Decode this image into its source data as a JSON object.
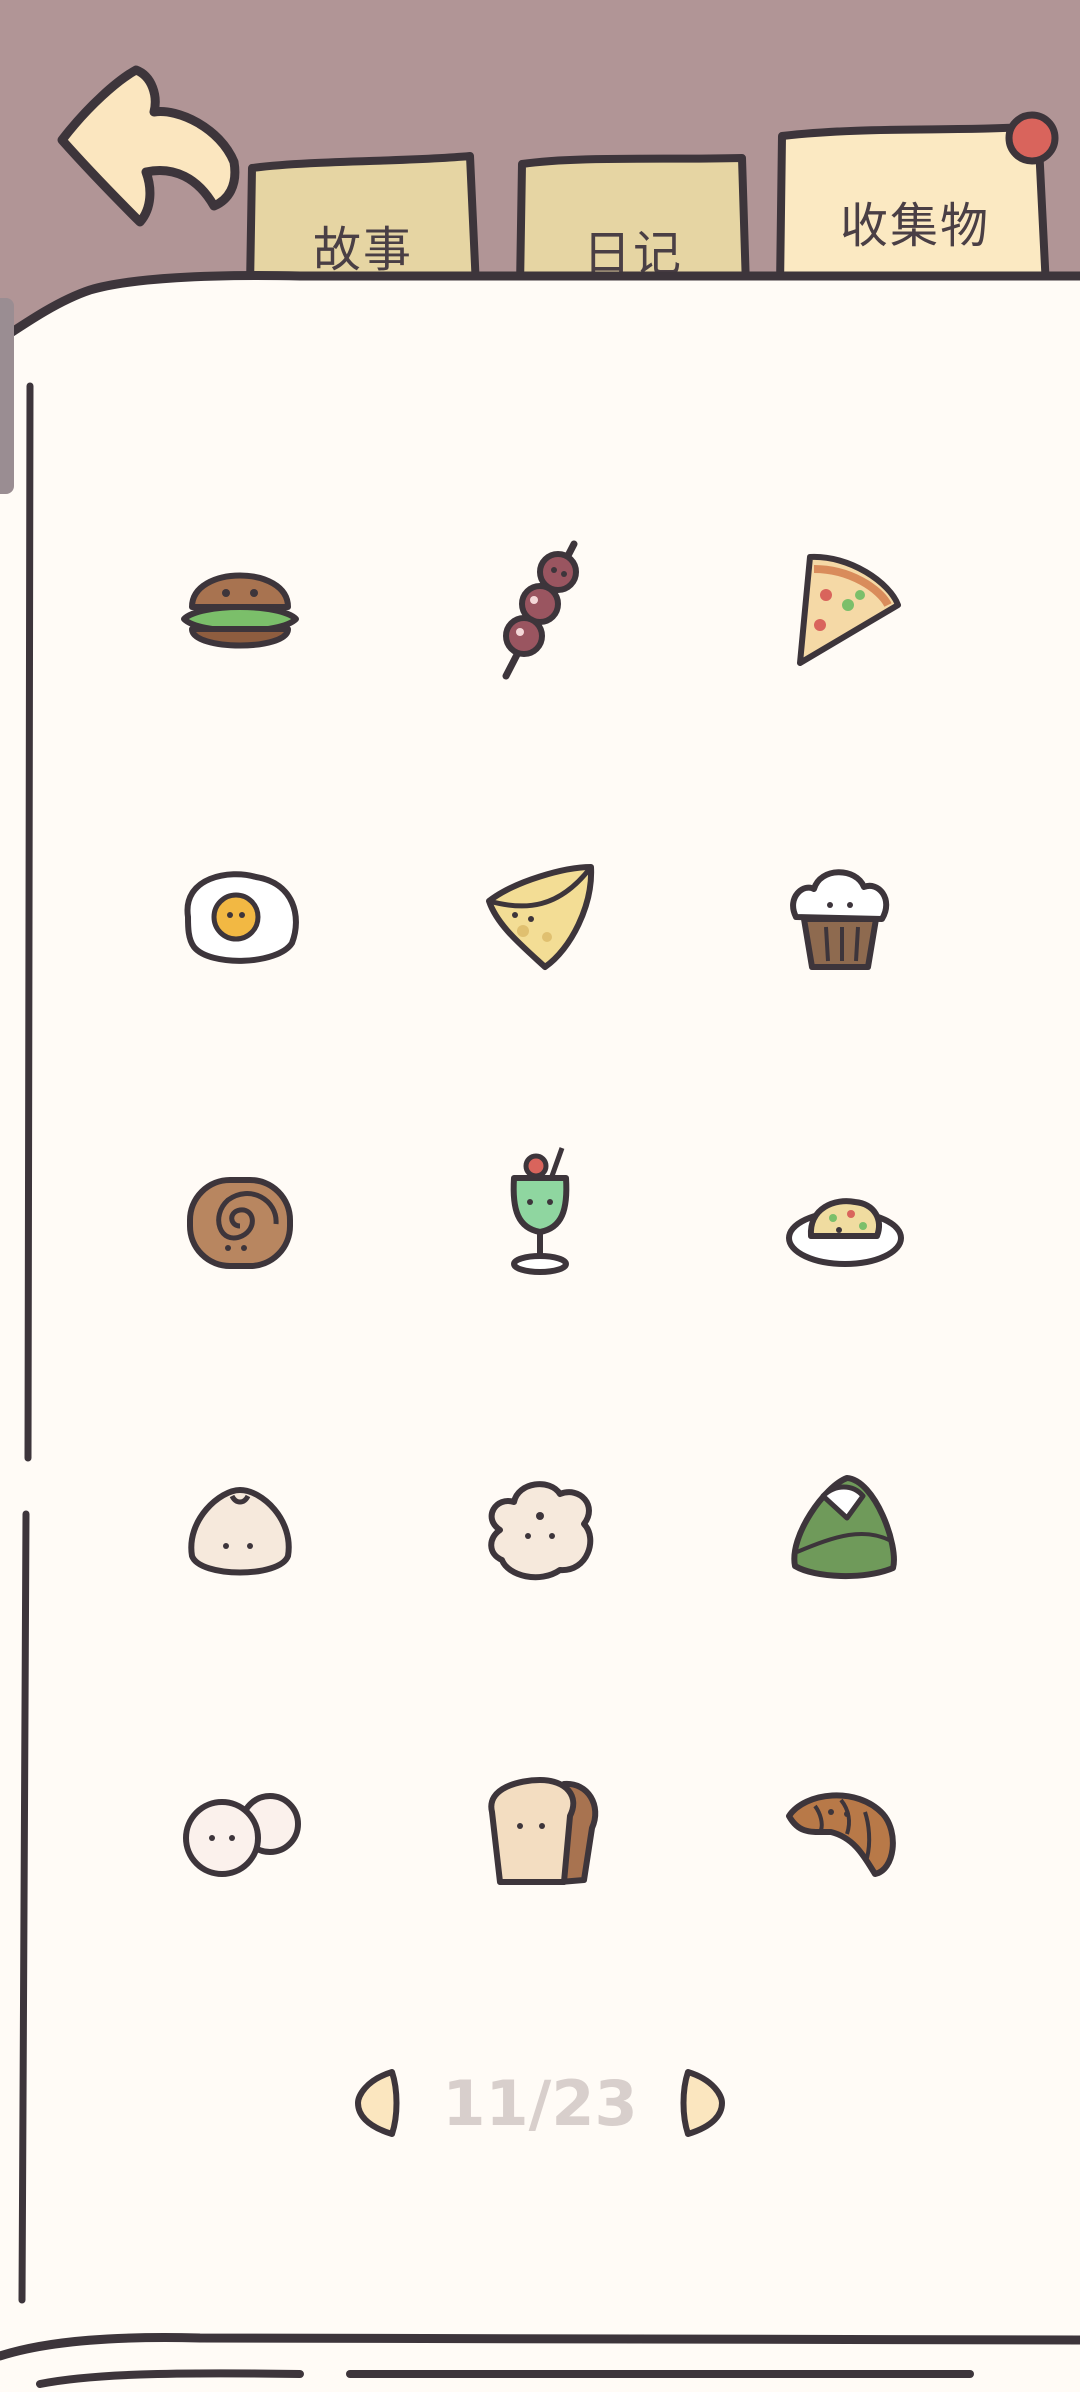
{
  "tabs": [
    {
      "label": "故事",
      "active": false
    },
    {
      "label": "日记",
      "active": false
    },
    {
      "label": "收集物",
      "active": true
    }
  ],
  "collection": {
    "items": [
      {
        "icon": "hamburger-icon"
      },
      {
        "icon": "meat-skewer-icon"
      },
      {
        "icon": "pizza-slice-icon"
      },
      {
        "icon": "fried-egg-icon"
      },
      {
        "icon": "cheese-wedge-icon"
      },
      {
        "icon": "muffin-icon"
      },
      {
        "icon": "cinnamon-roll-icon"
      },
      {
        "icon": "cream-soda-icon"
      },
      {
        "icon": "fried-rice-plate-icon"
      },
      {
        "icon": "steamed-bun-icon"
      },
      {
        "icon": "flower-bun-icon"
      },
      {
        "icon": "rice-dumpling-icon"
      },
      {
        "icon": "mochi-balls-icon"
      },
      {
        "icon": "bread-loaf-icon"
      },
      {
        "icon": "croissant-icon"
      }
    ]
  },
  "pagination": {
    "current": 11,
    "total": 23,
    "label": "11/23"
  },
  "colors": {
    "header_bg": "#b19596",
    "page_bg": "#fffbf6",
    "outline": "#3d353b",
    "tab_fill": "#e6d5a3",
    "active_tab_fill": "#fbe9c2",
    "notification_dot": "#d9645c",
    "page_indicator": "#d8cfcc"
  }
}
